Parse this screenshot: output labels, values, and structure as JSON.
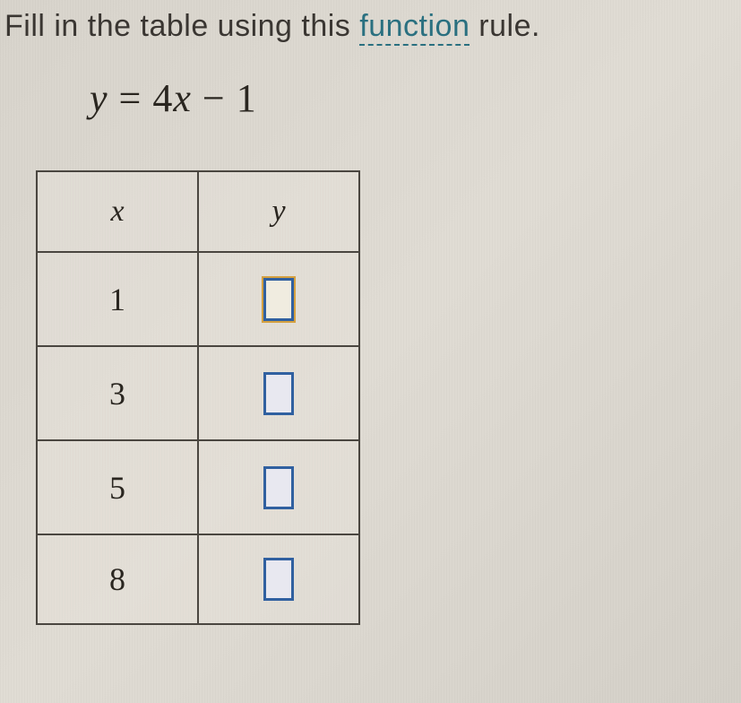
{
  "instruction": {
    "prefix": "Fill in the table using this ",
    "link_text": "function",
    "suffix": " rule."
  },
  "equation": {
    "display": "y = 4x − 1"
  },
  "table": {
    "headers": {
      "x": "x",
      "y": "y"
    },
    "rows": [
      {
        "x": "1",
        "y": ""
      },
      {
        "x": "3",
        "y": ""
      },
      {
        "x": "5",
        "y": ""
      },
      {
        "x": "8",
        "y": ""
      }
    ]
  }
}
